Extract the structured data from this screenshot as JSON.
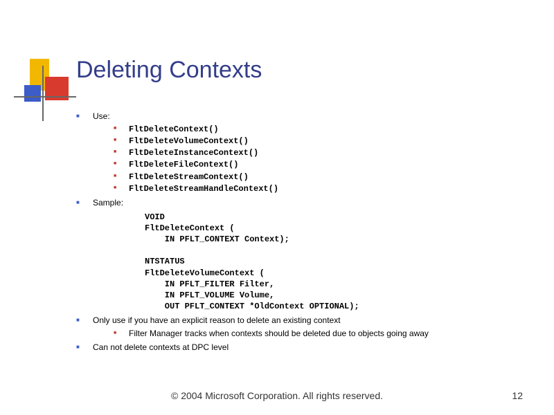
{
  "title": "Deleting Contexts",
  "bullets": {
    "use_label": "Use:",
    "use_items": [
      "FltDeleteContext()",
      "FltDeleteVolumeContext()",
      "FltDeleteInstanceContext()",
      "FltDeleteFileContext()",
      "FltDeleteStreamContext()",
      "FltDeleteStreamHandleContext()"
    ],
    "sample_label": "Sample:",
    "sample_code": "VOID\nFltDeleteContext (\n    IN PFLT_CONTEXT Context);\n\nNTSTATUS\nFltDeleteVolumeContext (\n    IN PFLT_FILTER Filter,\n    IN PFLT_VOLUME Volume,\n    OUT PFLT_CONTEXT *OldContext OPTIONAL);",
    "only_use": "Only use if you have an explicit reason to delete an existing context",
    "only_use_sub": "Filter Manager tracks when contexts should be deleted due to objects going away",
    "dpc": "Can not delete contexts at DPC level"
  },
  "footer": "© 2004 Microsoft Corporation. All rights reserved.",
  "page_number": "12"
}
